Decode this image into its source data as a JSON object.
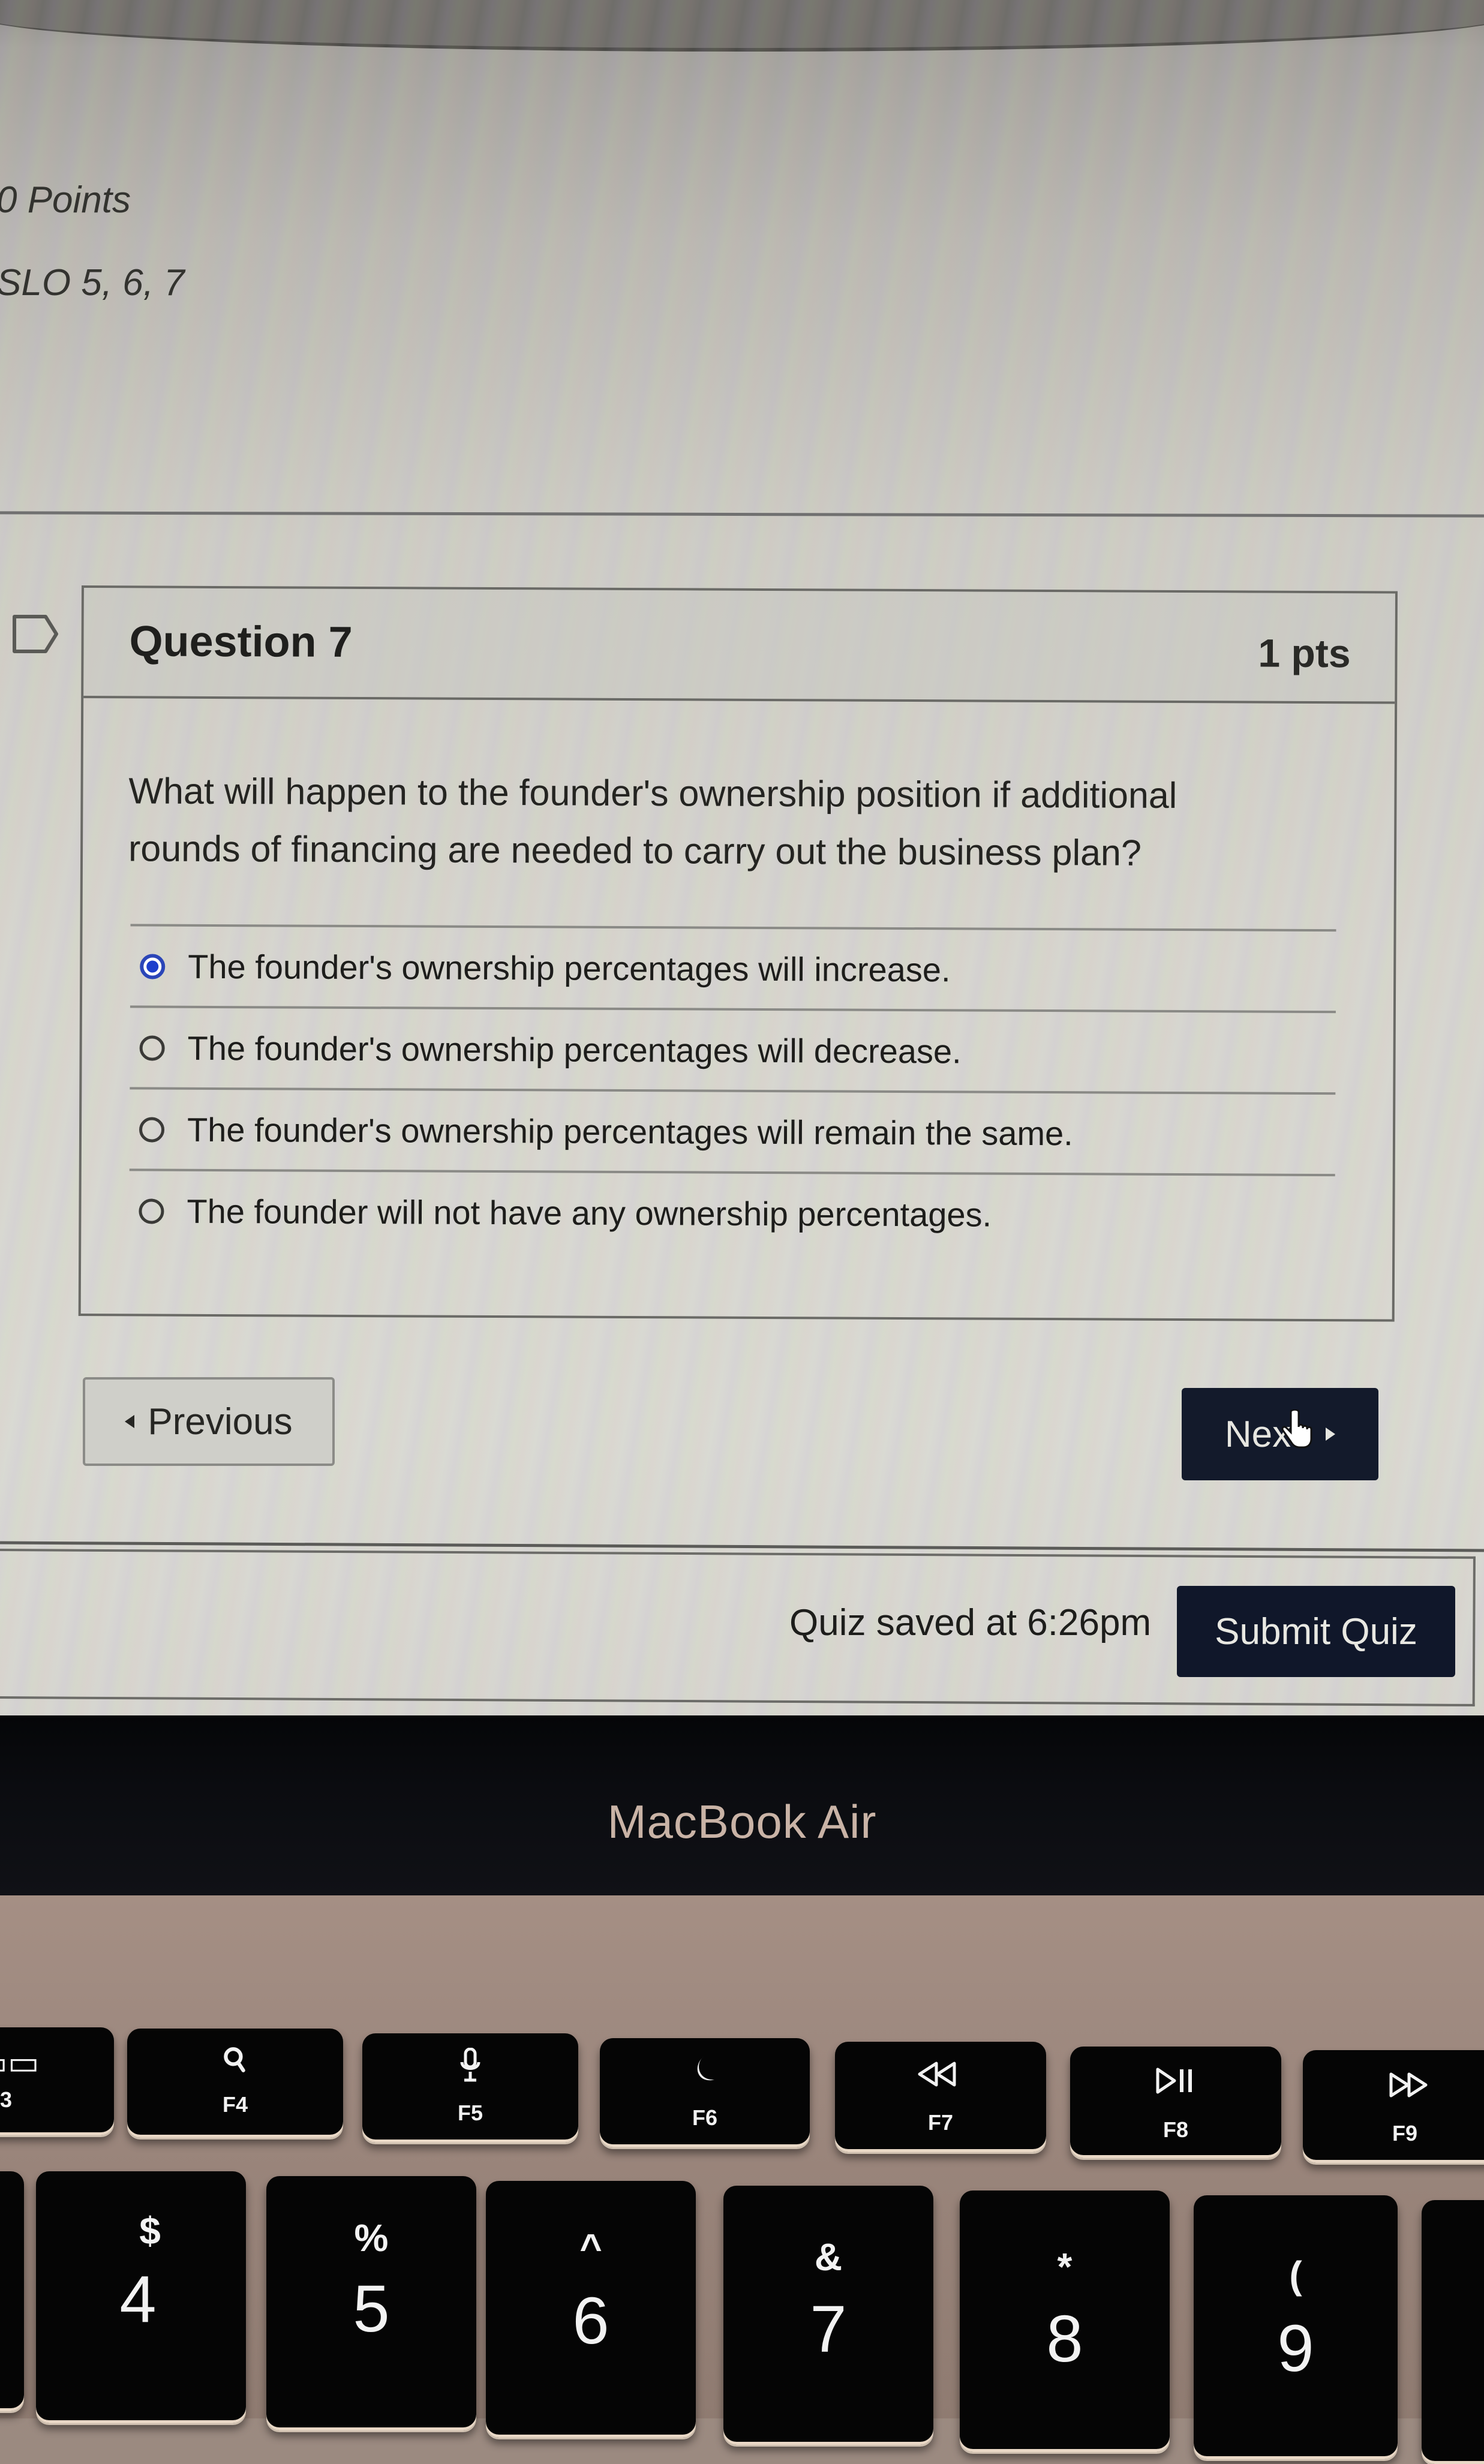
{
  "quiz": {
    "points_label": "0 Points",
    "slo_label": "SLO 5, 6, 7",
    "question": {
      "title": "Question 7",
      "points": "1 pts",
      "text_line1": "What will happen to the founder's ownership position if additional",
      "text_line2": "rounds of financing are needed to carry out the business plan?",
      "answers": [
        {
          "label": "The founder's ownership percentages will increase.",
          "selected": true
        },
        {
          "label": "The founder's ownership percentages will decrease.",
          "selected": false
        },
        {
          "label": "The founder's ownership percentages will remain the same.",
          "selected": false
        },
        {
          "label": "The founder will not have any ownership percentages.",
          "selected": false
        }
      ]
    },
    "nav": {
      "previous_label": "Previous",
      "next_label": "Nex"
    },
    "footer": {
      "saved_status": "Quiz saved at 6:26pm",
      "submit_label": "Submit Quiz"
    },
    "colors": {
      "selected_radio": "#1e3fcc",
      "primary_button": "#131a2b"
    }
  },
  "device": {
    "brand_label": "MacBook Air",
    "function_keys": [
      {
        "icon": "launchpad-icon",
        "fn": "F3",
        "glyph": "☰"
      },
      {
        "icon": "search-icon",
        "fn": "F4",
        "glyph": ""
      },
      {
        "icon": "microphone-icon",
        "fn": "F5",
        "glyph": ""
      },
      {
        "icon": "moon-icon",
        "fn": "F6",
        "glyph": "☾"
      },
      {
        "icon": "rewind-icon",
        "fn": "F7",
        "glyph": "⏪"
      },
      {
        "icon": "play-pause-icon",
        "fn": "F8",
        "glyph": "⏯"
      },
      {
        "icon": "fast-forward-icon",
        "fn": "F9",
        "glyph": "⏩"
      }
    ],
    "number_keys": [
      {
        "shift": "$",
        "num": "4"
      },
      {
        "shift": "%",
        "num": "5"
      },
      {
        "shift": "^",
        "num": "6"
      },
      {
        "shift": "&",
        "num": "7"
      },
      {
        "shift": "*",
        "num": "8"
      },
      {
        "shift": "(",
        "num": "9"
      }
    ]
  }
}
